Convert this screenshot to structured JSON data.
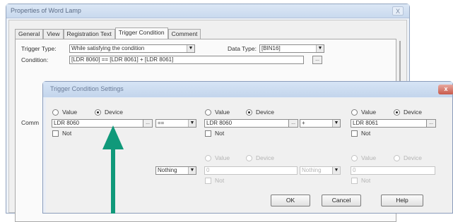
{
  "back_window": {
    "title": "Properties of Word Lamp",
    "close": "X",
    "tabs": [
      "General",
      "View",
      "Registration Text",
      "Trigger Condition",
      "Comment"
    ],
    "active_tab": "Trigger Condition",
    "trigger_type_label": "Trigger Type:",
    "trigger_type_value": "While satisfying the condition",
    "data_type_label": "Data Type:",
    "data_type_value": "[BIN16]",
    "condition_label": "Condition:",
    "condition_value": "[LDR 8060] == [LDR 8061] + [LDR 8061]",
    "comment_label": "Comm",
    "dots": "..."
  },
  "dialog": {
    "title": "Trigger Condition Settings",
    "close": "x",
    "left": {
      "value_label": "Value",
      "device_label": "Device",
      "device_value": "LDR 8060",
      "not_label": "Not"
    },
    "operator": "==",
    "middle": {
      "value_label": "Value",
      "device_label": "Device",
      "device_value": "LDR 8060",
      "not_label": "Not",
      "value2_label": "Value",
      "device2_label": "Device",
      "not2_label": "Not",
      "operator2": "+",
      "input2": "0"
    },
    "right": {
      "value_label": "Value",
      "device_label": "Device",
      "device_value": "LDR 8061",
      "not_label": "Not",
      "value2_label": "Value",
      "device2_label": "Device",
      "not2_label": "Not",
      "input2": "0"
    },
    "nothing_value": "Nothing",
    "second_op": "Nothing",
    "ok_label": "OK",
    "cancel_label": "Cancel",
    "help_label": "Help",
    "dots": "..."
  },
  "annotation": {
    "color": "#10997a"
  }
}
